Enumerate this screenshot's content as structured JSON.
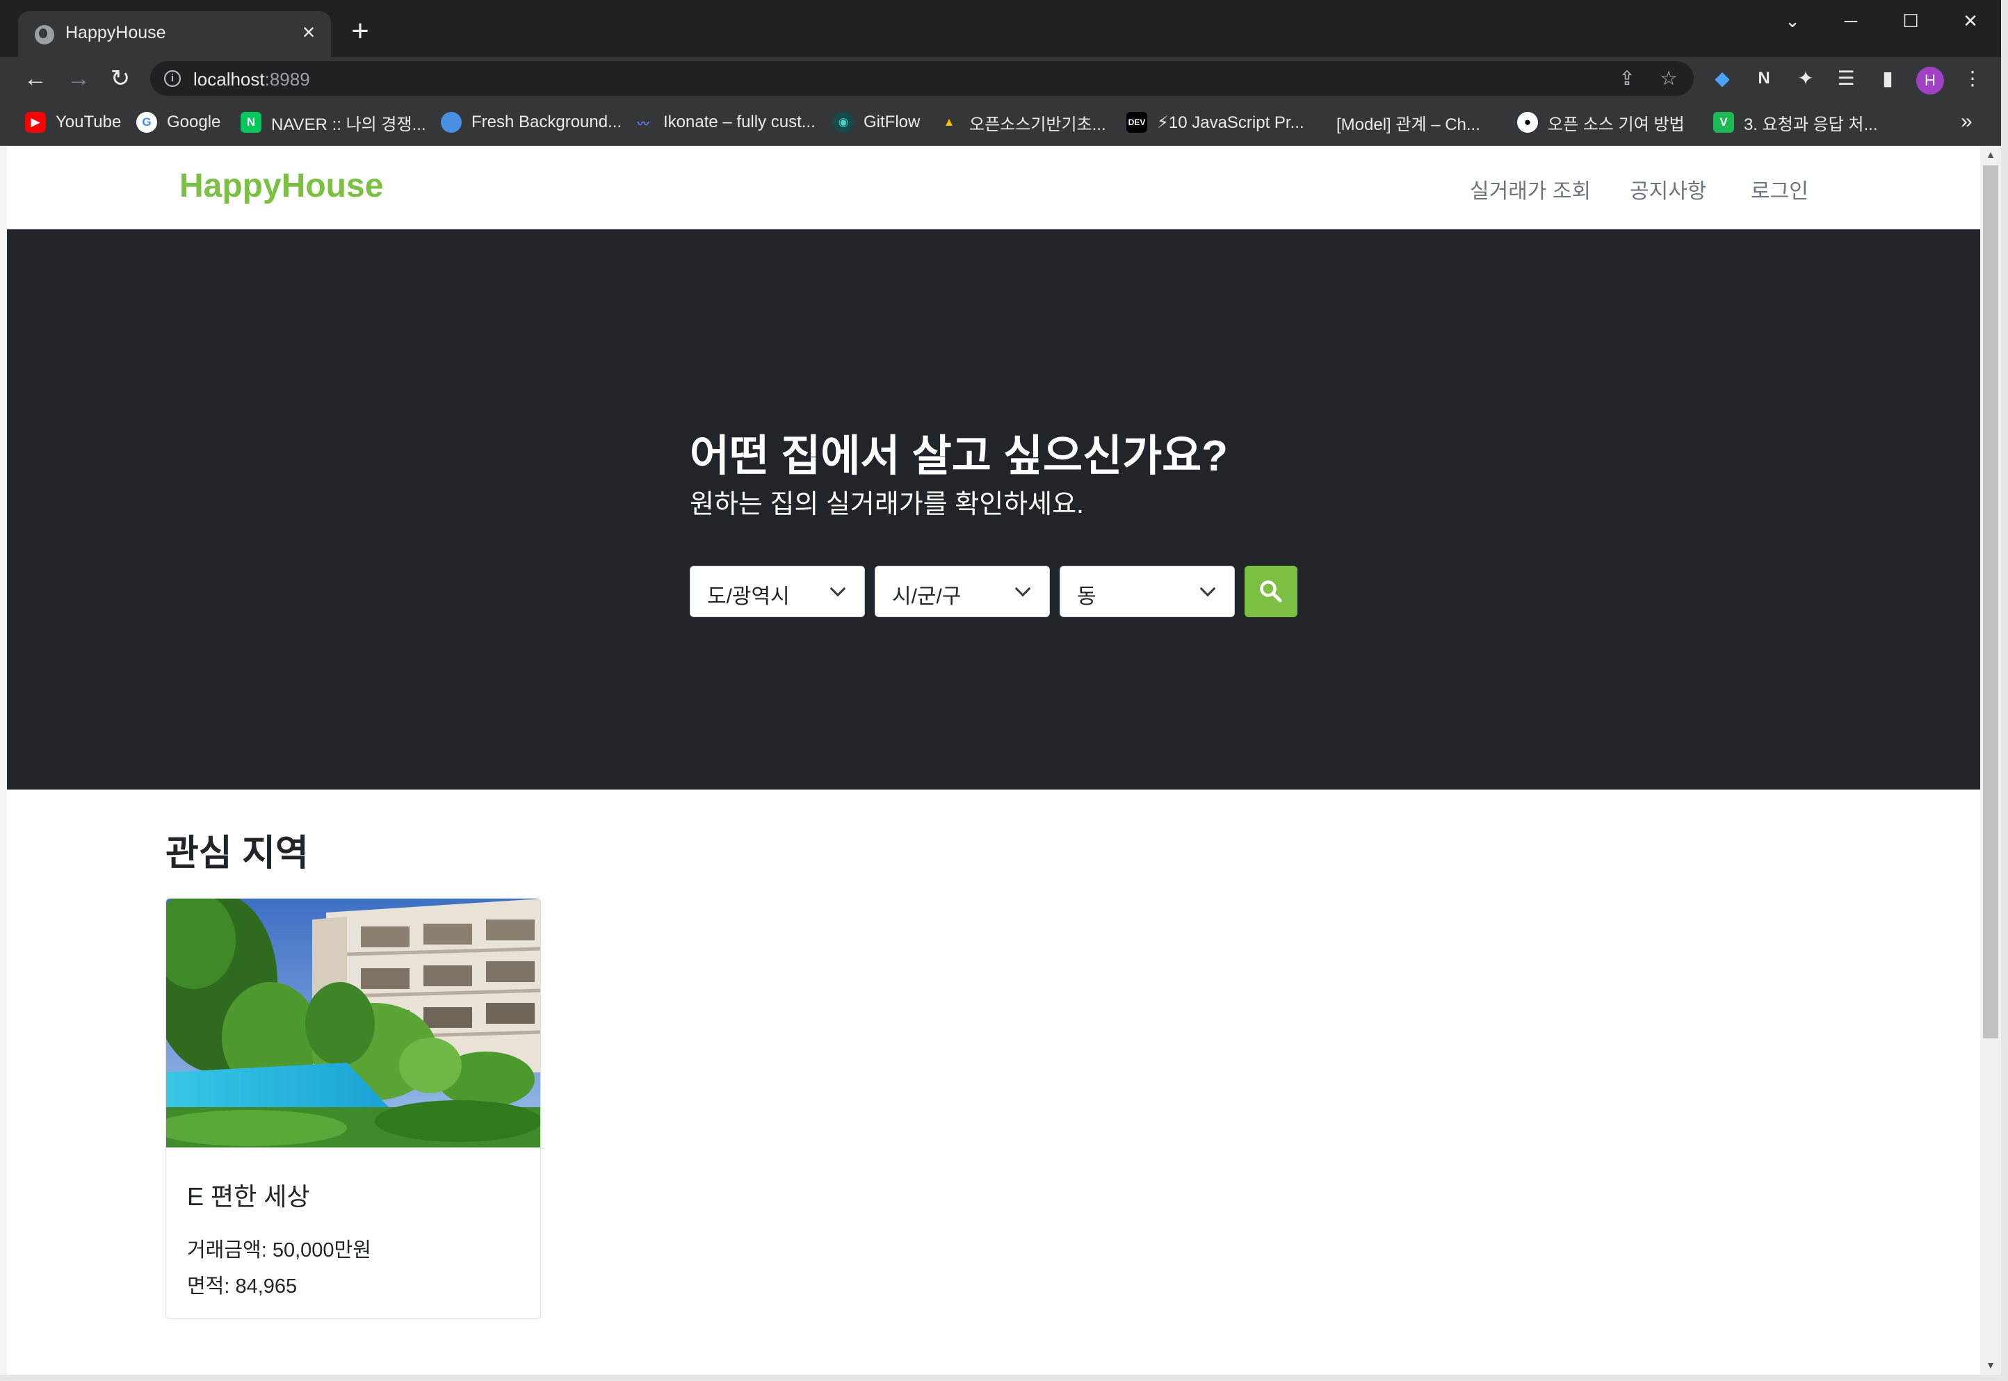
{
  "browser": {
    "tab_title": "HappyHouse",
    "url_host": "localhost",
    "url_port": ":8989",
    "profile_initial": "H",
    "bookmarks": [
      {
        "label": "YouTube",
        "icon": "youtube-icon",
        "color": "#ff0000"
      },
      {
        "label": "Google",
        "icon": "google-icon",
        "color": "#ffffff"
      },
      {
        "label": "NAVER :: 나의 경쟁...",
        "icon": "naver-icon",
        "color": "#03c75a"
      },
      {
        "label": "Fresh Background...",
        "icon": "fresh-background-icon",
        "color": "#4a90e2"
      },
      {
        "label": "Ikonate – fully cust...",
        "icon": "ikonate-icon",
        "color": "#3b5bdb"
      },
      {
        "label": "GitFlow",
        "icon": "gitflow-icon",
        "color": "#3aa"
      },
      {
        "label": "오픈소스기반기초...",
        "icon": "google-drive-icon",
        "color": "#fbbc04"
      },
      {
        "label": "⚡10 JavaScript Pr...",
        "icon": "dev-icon",
        "color": "#000000"
      },
      {
        "label": "[Model] 관계 – Ch...",
        "icon": "blank-page-icon",
        "color": "#35363a"
      },
      {
        "label": "오픈 소스 기여 방법",
        "icon": "github-icon",
        "color": "#ffffff"
      },
      {
        "label": "3. 요청과 응답 처...",
        "icon": "vue-v-icon",
        "color": "#1db954"
      }
    ],
    "bookmarks_more": "»"
  },
  "site": {
    "brand": "HappyHouse",
    "nav": [
      "실거래가 조회",
      "공지사항",
      "로그인"
    ]
  },
  "hero": {
    "title": "어떤 집에서 살고 싶으신가요?",
    "subtitle": "원하는 집의 실거래가를 확인하세요.",
    "selects": [
      "도/광역시",
      "시/군/구",
      "동"
    ]
  },
  "favorites": {
    "title": "관심 지역",
    "cards": [
      {
        "name": "E 편한 세상",
        "price_label": "거래금액: ",
        "price": "50,000만원",
        "area_label": "면적: ",
        "area": "84,965"
      }
    ]
  },
  "colors": {
    "brand_green": "#7cc043",
    "hero_bg": "#212529",
    "chrome_bg": "#202124"
  }
}
